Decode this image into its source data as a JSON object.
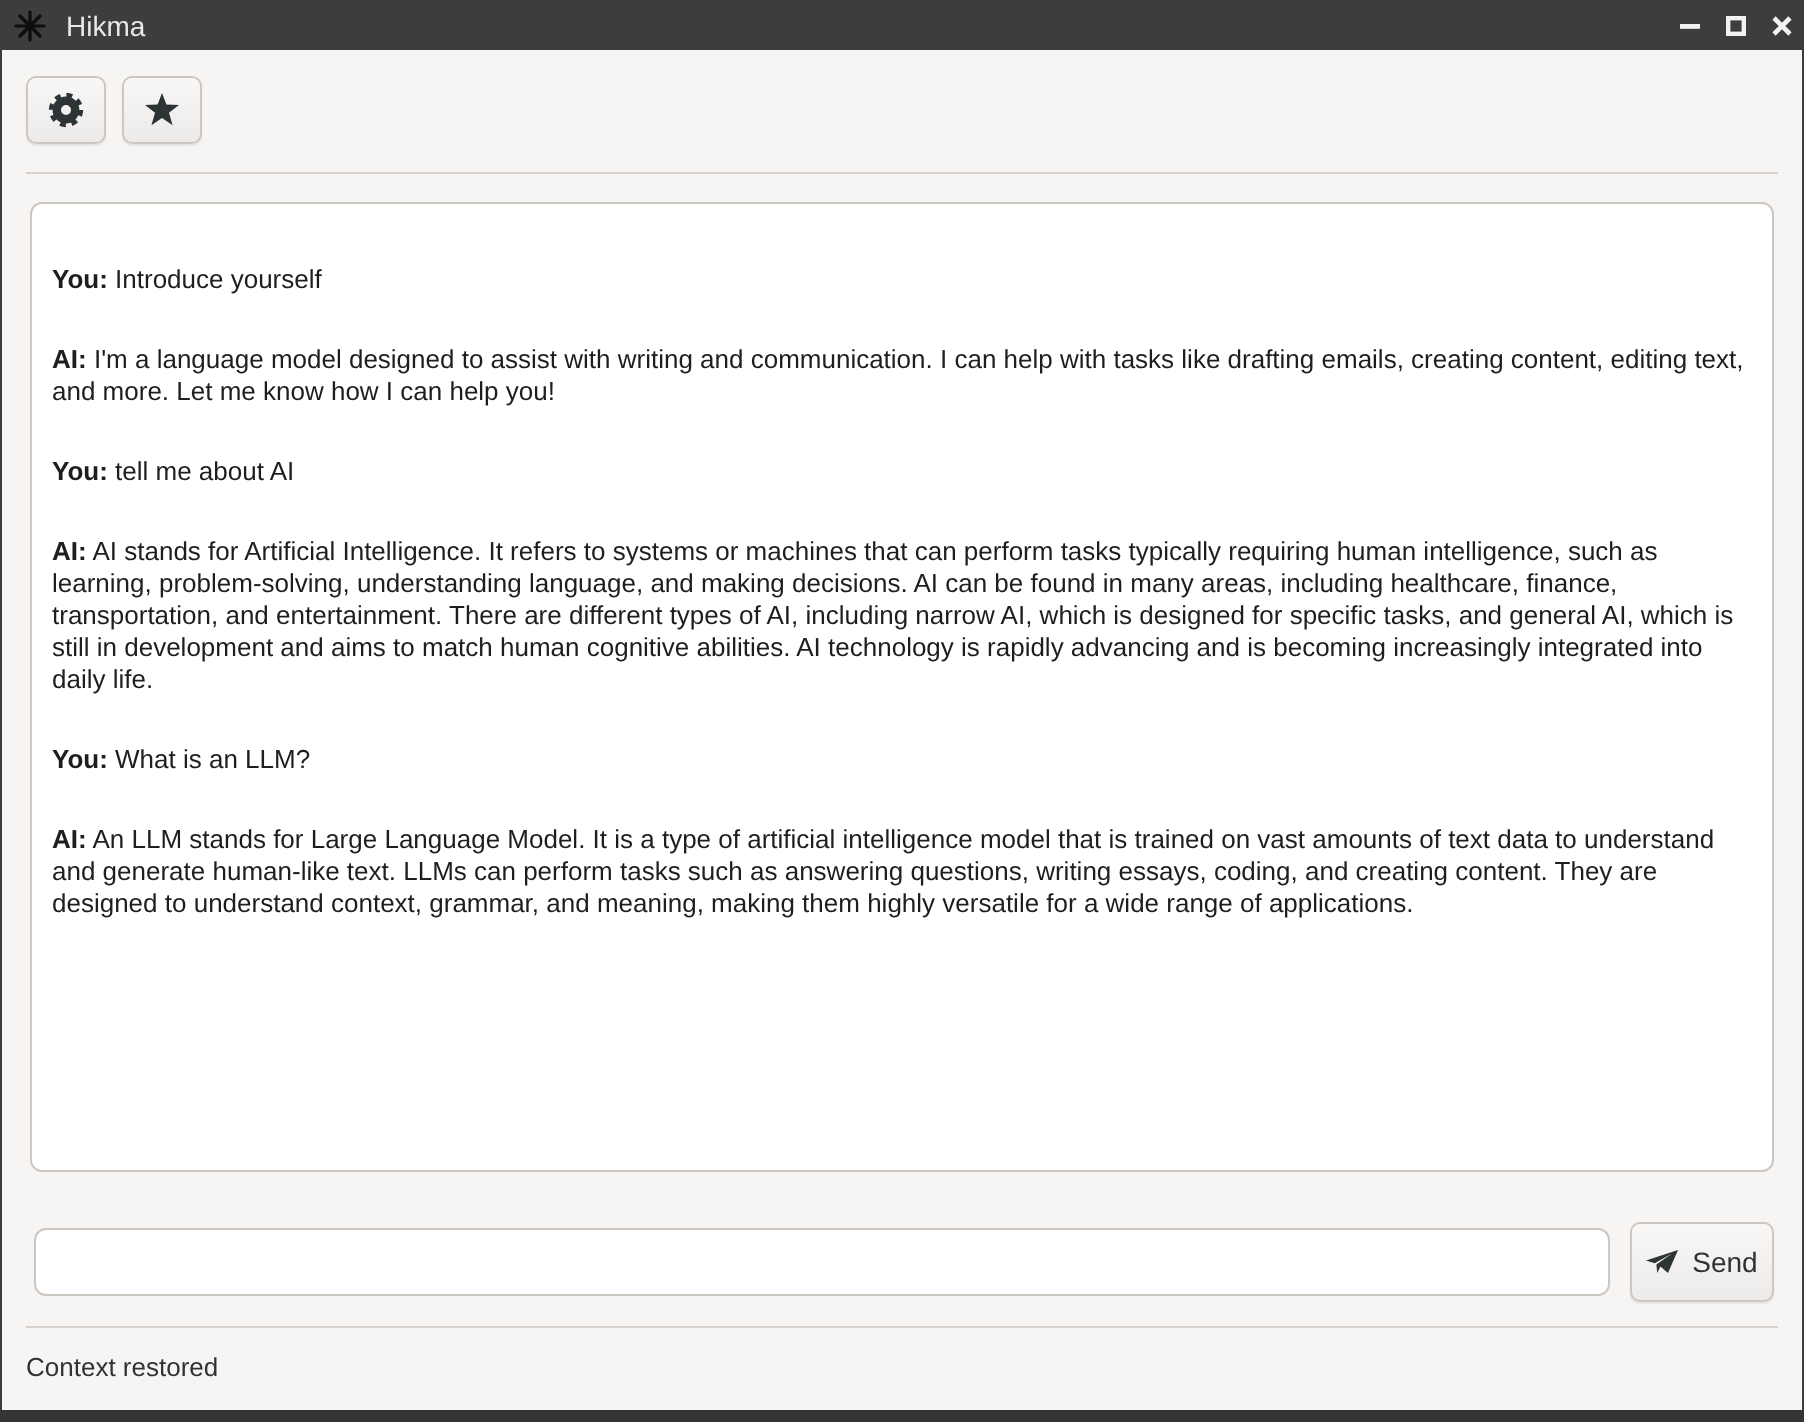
{
  "window": {
    "title": "Hikma"
  },
  "chat": {
    "messages": [
      {
        "speaker": "You:",
        "text": "Introduce yourself"
      },
      {
        "speaker": "AI:",
        "text": "I'm a language model designed to assist with writing and communication. I can help with tasks like drafting emails, creating content, editing text, and more. Let me know how I can help you!"
      },
      {
        "speaker": "You:",
        "text": "tell me about AI"
      },
      {
        "speaker": "AI:",
        "text": "AI stands for Artificial Intelligence. It refers to systems or machines that can perform tasks typically requiring human intelligence, such as learning, problem-solving, understanding language, and making decisions. AI can be found in many areas, including healthcare, finance, transportation, and entertainment. There are different types of AI, including narrow AI, which is designed for specific tasks, and general AI, which is still in development and aims to match human cognitive abilities. AI technology is rapidly advancing and is becoming increasingly integrated into daily life."
      },
      {
        "speaker": "You:",
        "text": "What is an LLM?"
      },
      {
        "speaker": "AI:",
        "text": "An LLM stands for Large Language Model. It is a type of artificial intelligence model that is trained on vast amounts of text data to understand and generate human-like text. LLMs can perform tasks such as answering questions, writing essays, coding, and creating content. They are designed to understand context, grammar, and meaning, making them highly versatile for a wide range of applications."
      }
    ]
  },
  "composer": {
    "send_label": "Send"
  },
  "status_bar": {
    "text": "Context restored"
  }
}
